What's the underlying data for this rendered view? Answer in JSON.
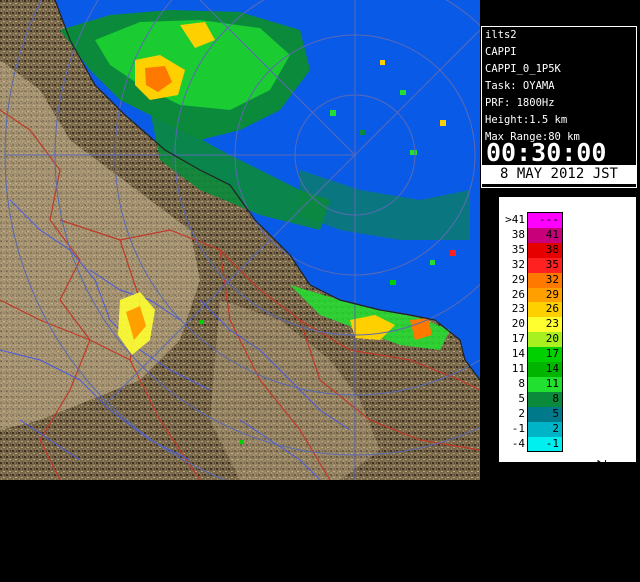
{
  "info": {
    "lines": [
      "ilts2",
      "CAPPI",
      "CAPPI_0_1P5K",
      "Task: OYAMA",
      "PRF: 1800Hz",
      "Height:1.5 km",
      "Max Range:80 km"
    ],
    "time": "00:30:00",
    "date": "8 MAY 2012 JST"
  },
  "legend": {
    "title": "Reflectivity in dBZ",
    "bins": [
      {
        "lo": ">41",
        "hi": "---",
        "color": "#ff00ff"
      },
      {
        "lo": "38",
        "hi": "41",
        "color": "#c8007a"
      },
      {
        "lo": "35",
        "hi": "38",
        "color": "#e60000"
      },
      {
        "lo": "32",
        "hi": "35",
        "color": "#ff2020"
      },
      {
        "lo": "29",
        "hi": "32",
        "color": "#ff7800"
      },
      {
        "lo": "26",
        "hi": "29",
        "color": "#ffa000"
      },
      {
        "lo": "23",
        "hi": "26",
        "color": "#ffd000"
      },
      {
        "lo": "20",
        "hi": "23",
        "color": "#ffff30"
      },
      {
        "lo": "17",
        "hi": "20",
        "color": "#a8f020"
      },
      {
        "lo": "14",
        "hi": "17",
        "color": "#00d000"
      },
      {
        "lo": "11",
        "hi": "14",
        "color": "#00b400"
      },
      {
        "lo": "8",
        "hi": "11",
        "color": "#22e030"
      },
      {
        "lo": "5",
        "hi": "8",
        "color": "#0a8a3a"
      },
      {
        "lo": "2",
        "hi": "5",
        "color": "#007a8a"
      },
      {
        "lo": "-1",
        "hi": "2",
        "color": "#00b4c8"
      },
      {
        "lo": "-4",
        "hi": "-1",
        "color": "#00f0f0"
      }
    ]
  },
  "colors": {
    "ocean": "#0a5ae8",
    "outer": "#0000b4",
    "land": "#7c6a4c",
    "rings": "#5a6ab4",
    "rivers": "#4a5ae0",
    "boundaries": "#c03a2a"
  }
}
